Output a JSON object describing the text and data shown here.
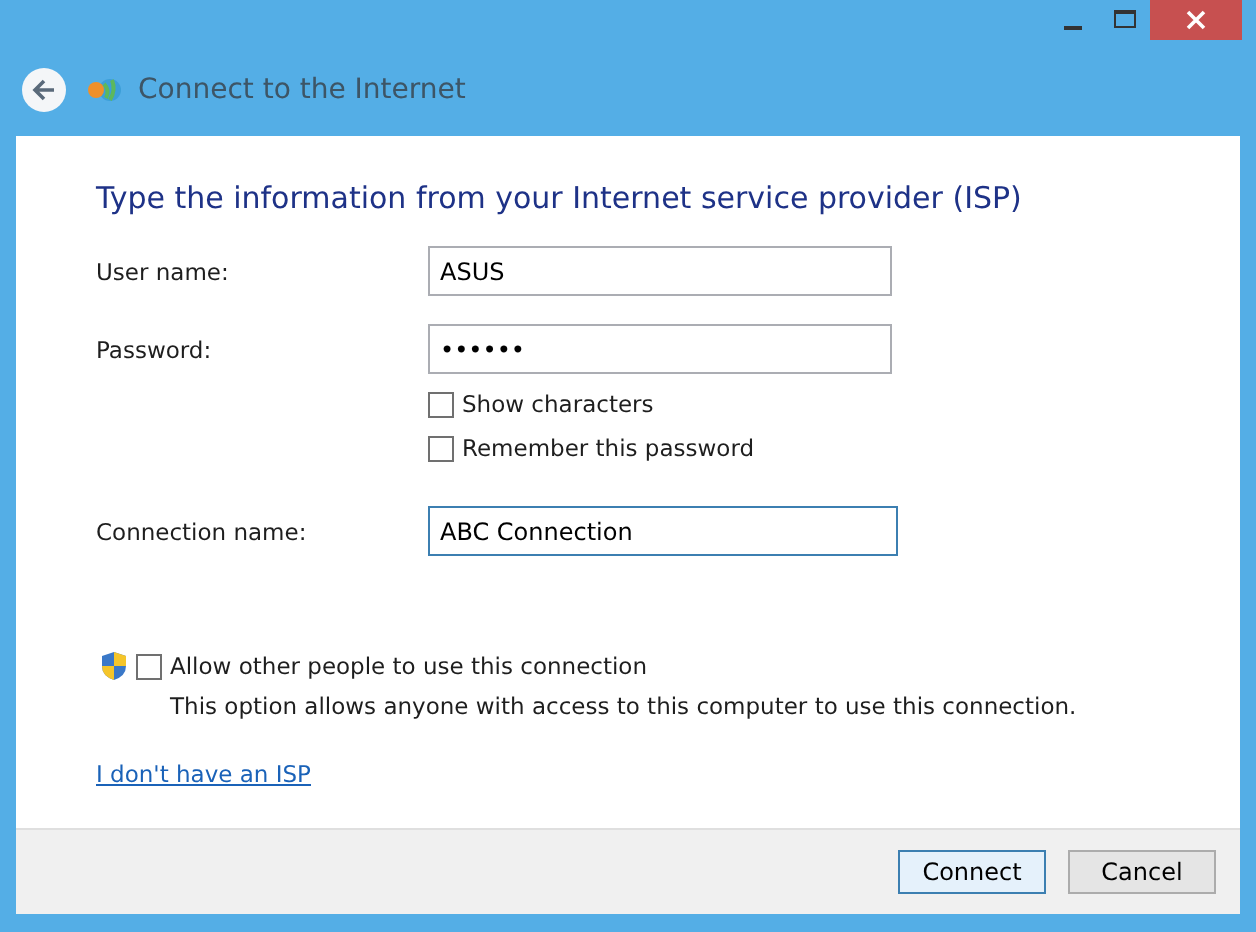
{
  "window": {
    "title": "Connect to the Internet"
  },
  "heading": "Type the information from your Internet service provider (ISP)",
  "fields": [
    {
      "label": "User name:",
      "value": "ASUS",
      "focused": false
    },
    {
      "label": "Password:",
      "value": "••••••",
      "focused": false
    },
    {
      "label": "Connection name:",
      "value": "ABC Connection",
      "focused": true
    }
  ],
  "password_options": [
    {
      "label": "Show characters",
      "checked": false
    },
    {
      "label": "Remember this password",
      "checked": false
    }
  ],
  "allow_others": {
    "label": "Allow other people to use this connection",
    "checked": false,
    "description": "This option allows anyone with access to this computer to use this connection."
  },
  "link": "I don't have an ISP",
  "buttons": [
    {
      "label": "Connect",
      "default": true
    },
    {
      "label": "Cancel",
      "default": false
    }
  ]
}
